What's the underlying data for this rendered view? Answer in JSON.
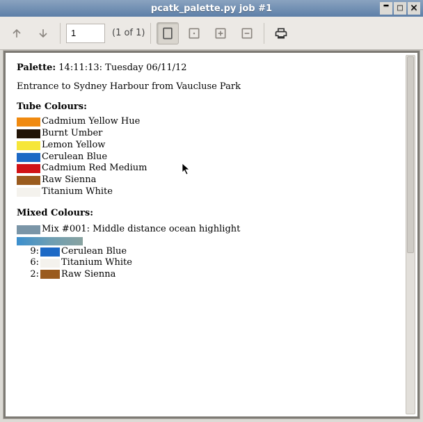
{
  "window": {
    "title": "pcatk_palette.py job #1"
  },
  "toolbar": {
    "page_value": "1",
    "page_label": "(1 of 1)"
  },
  "doc": {
    "palette_label": "Palette:",
    "timestamp": "14:11:13: Tuesday 06/11/12",
    "description": "Entrance to Sydney Harbour from Vaucluse Park",
    "tube_header": "Tube Colours:",
    "tube": [
      {
        "name": "Cadmium Yellow Hue",
        "color": "#f08a10"
      },
      {
        "name": "Burnt Umber",
        "color": "#221407"
      },
      {
        "name": "Lemon Yellow",
        "color": "#f6e63a"
      },
      {
        "name": "Cerulean Blue",
        "color": "#1d69c5"
      },
      {
        "name": "Cadmium Red Medium",
        "color": "#d11216"
      },
      {
        "name": "Raw Sienna",
        "color": "#9a5b1e"
      },
      {
        "name": "Titanium White",
        "color": "#f4f2ed"
      }
    ],
    "mixed_header": "Mixed Colours:",
    "mix_label": "Mix #001: Middle distance ocean highlight",
    "mix_swatch": "#7a95a7",
    "mix": [
      {
        "ratio": "9:",
        "color": "#1d69c5",
        "name": "Cerulean Blue"
      },
      {
        "ratio": "6:",
        "color": "#f4f2ed",
        "name": "Titanium White"
      },
      {
        "ratio": "2:",
        "color": "#9a5b1e",
        "name": "Raw Sienna"
      }
    ]
  }
}
